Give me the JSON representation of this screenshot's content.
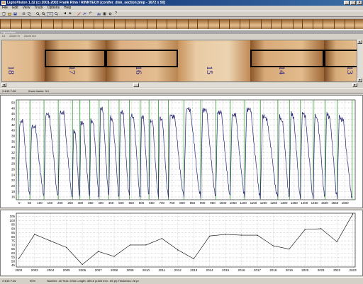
{
  "window": {
    "title": "LignoVision 1.32  (c) 2001-2002 Frank Rinn / RINNTECH  [conifer_disk_section.bmp - 1672 x 50]"
  },
  "menu": [
    "File",
    "Edit",
    "View",
    "Track",
    "Options",
    "Help"
  ],
  "toolbar": {
    "zoom_value": "95"
  },
  "subwindow": {
    "title": "LignoVision",
    "items": [
      "Lit",
      "Zoom in",
      "Zoom out"
    ]
  },
  "rings": [
    "18",
    "17",
    "16",
    "15",
    "14",
    "13"
  ],
  "status_top": {
    "coords": "X:615 Y:26",
    "zoom": "Zoom factor: 3:1"
  },
  "density_chart": {
    "type": "line",
    "y_ticks": [
      "50",
      "48",
      "46",
      "44",
      "42",
      "40",
      "38",
      "36",
      "34",
      "32",
      "30",
      "28",
      "26",
      "24",
      "22",
      "20",
      "18",
      "16"
    ],
    "x_ticks": [
      "0",
      "50",
      "100",
      "150",
      "200",
      "250",
      "300",
      "350",
      "400",
      "450",
      "500",
      "550",
      "600",
      "650",
      "700",
      "750",
      "800",
      "850",
      "900",
      "950",
      "1000",
      "1050",
      "1100",
      "1150",
      "1200",
      "1250",
      "1300",
      "1350",
      "1400",
      "1450",
      "1500",
      "1550",
      "1600"
    ],
    "ylim": [
      15,
      51
    ],
    "xlim": [
      -15,
      1650
    ],
    "boundaries": [
      -5,
      52,
      121,
      191,
      261,
      296,
      345,
      392,
      440,
      490,
      541,
      594,
      637,
      683,
      732,
      809,
      891,
      965,
      1036,
      1107,
      1184,
      1270,
      1327,
      1381,
      1444,
      1502,
      1562,
      1635
    ],
    "peaks": [
      44,
      42,
      46,
      47,
      40,
      43,
      44,
      48,
      45,
      47,
      46,
      45,
      44,
      45,
      46,
      48,
      48,
      47,
      46,
      48,
      45,
      45,
      46,
      46,
      45,
      46,
      45
    ]
  },
  "chart_data": {
    "type": "line",
    "x": [
      2002,
      2003,
      2004,
      2005,
      2006,
      2007,
      2008,
      2009,
      2010,
      2011,
      2012,
      2013,
      2014,
      2015,
      2016,
      2017,
      2018,
      2019,
      2020,
      2021,
      2022,
      2023
    ],
    "values": [
      53,
      83,
      75,
      67,
      46,
      62,
      56,
      70,
      70,
      78,
      64,
      53,
      81,
      83,
      82,
      82,
      69,
      65,
      89,
      90,
      74,
      108
    ],
    "x_ticks": [
      "2002",
      "2003",
      "2004",
      "2005",
      "2006",
      "2007",
      "2008",
      "2009",
      "2010",
      "2011",
      "2012",
      "2013",
      "2014",
      "2015",
      "2016",
      "2017",
      "2018",
      "2019",
      "2020",
      "2021",
      "2022",
      "2023"
    ],
    "y_ticks": [
      "105",
      "100",
      "95",
      "90",
      "85",
      "80",
      "75",
      "70",
      "65",
      "60",
      "55",
      "50",
      "45"
    ],
    "ylim": [
      43,
      109
    ],
    "grid": true
  },
  "statusbar": {
    "coords": "X:615 Y:26",
    "percent": "90%",
    "info": "Number: 15  Year: 2016  Length: 359.8 (1300 mm : 85 pt)  Thickness: 28 pt"
  },
  "colors": {
    "density_line": "#22226e",
    "boundary_line": "#2f9a2f",
    "grid": "#b0b0b0",
    "wood_light": "#e1bd8f",
    "wood_dark": "#8a5a2e"
  }
}
